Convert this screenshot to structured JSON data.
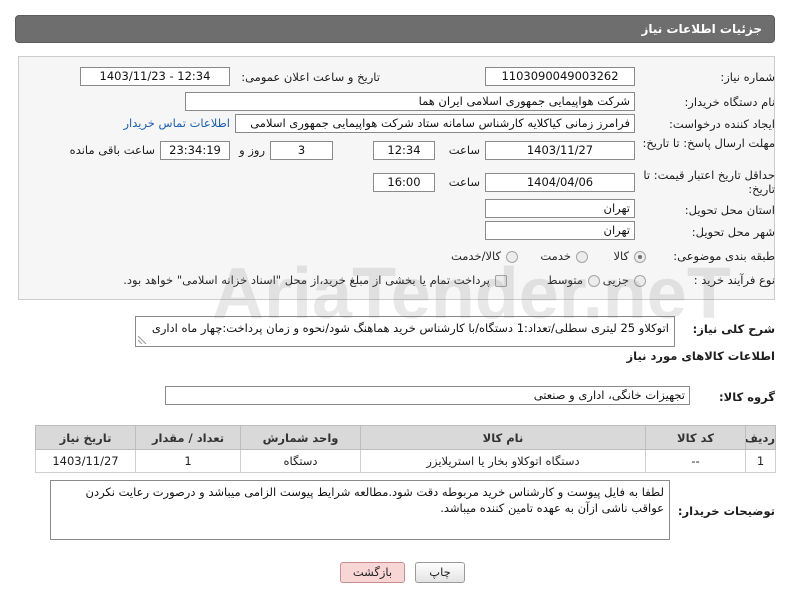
{
  "header": {
    "title": "جزئیات اطلاعات نیاز"
  },
  "details": {
    "need_number": {
      "label": "شماره نیاز:",
      "value": "1103090049003262"
    },
    "announce": {
      "label": "تاریخ و ساعت اعلان عمومی:",
      "value": "1403/11/23 - 12:34"
    },
    "buyer_org": {
      "label": "نام دستگاه خریدار:",
      "value": "شرکت هواپیمایی جمهوری اسلامی ایران هما"
    },
    "requester": {
      "label": "ایجاد کننده درخواست:",
      "value": "فرامرز زمانی کیاکلایه کارشناس سامانه ستاد شرکت هواپیمایی جمهوری اسلامی",
      "contact_link": "اطلاعات تماس خریدار"
    },
    "reply_deadline": {
      "label": "مهلت ارسال پاسخ: تا تاریخ:",
      "date": "1403/11/27",
      "time_label": "ساعت",
      "time": "12:34",
      "days": "3",
      "days_label": "روز و",
      "remaining": "23:34:19",
      "remaining_label": "ساعت باقی مانده"
    },
    "price_validity": {
      "label": "حداقل تاریخ اعتبار قیمت: تا تاریخ:",
      "date": "1404/04/06",
      "time_label": "ساعت",
      "time": "16:00"
    },
    "province": {
      "label": "استان محل تحویل:",
      "value": "تهران"
    },
    "city": {
      "label": "شهر محل تحویل:",
      "value": "تهران"
    },
    "category": {
      "label": "طبقه بندی موضوعی:",
      "options": [
        {
          "label": "کالا",
          "selected": true
        },
        {
          "label": "خدمت",
          "selected": false
        },
        {
          "label": "کالا/خدمت",
          "selected": false
        }
      ]
    },
    "process_type": {
      "label": "نوع فرآیند خرید :",
      "options": [
        {
          "label": "جزیی",
          "selected": false
        },
        {
          "label": "متوسط",
          "selected": false
        }
      ],
      "treasury": {
        "label": "پرداخت تمام یا بخشی از مبلغ خرید،از محل \"اسناد خزانه اسلامی\" خواهد بود.",
        "checked": false
      }
    }
  },
  "description": {
    "label": "شرح کلی نیاز:",
    "value": "اتوکلاو 25 لیتری سطلی/تعداد:1 دستگاه/با کارشناس خرید هماهنگ شود/نحوه و زمان پرداخت:چهار ماه اداری"
  },
  "goods": {
    "section_title": "اطلاعات کالاهای مورد نیاز",
    "group_label": "گروه کالا:",
    "group_value": "تجهیزات خانگی، اداری و صنعتی",
    "table": {
      "columns": [
        "ردیف",
        "کد کالا",
        "نام کالا",
        "واحد شمارش",
        "تعداد / مقدار",
        "تاریخ نیاز"
      ],
      "rows": [
        [
          "1",
          "--",
          "دستگاه اتوکلاو بخار یا استریلایزر",
          "دستگاه",
          "1",
          "1403/11/27"
        ]
      ]
    }
  },
  "buyer_notes": {
    "label": "توضیحات خریدار:",
    "value": "لطفا به فایل پیوست و کارشناس خرید مربوطه دقت شود.مطالعه شرایط پیوست الزامی میباشد و درصورت رعایت نکردن عواقب ناشی ازآن به عهده تامین کننده میباشد."
  },
  "buttons": {
    "print": "چاپ",
    "back": "بازگشت"
  },
  "watermark": "AriaTender.neT",
  "colors": {
    "header_bg": "#6e6e6e",
    "link": "#1a5fb4",
    "back_button_bg": "#f9d6d6"
  }
}
